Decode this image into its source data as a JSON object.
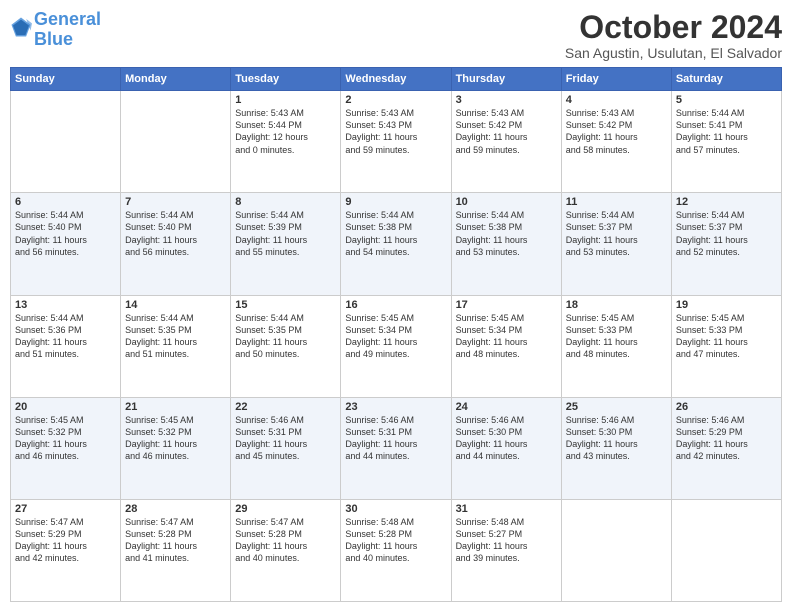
{
  "header": {
    "logo_line1": "General",
    "logo_line2": "Blue",
    "month_title": "October 2024",
    "location": "San Agustin, Usulutan, El Salvador"
  },
  "days_of_week": [
    "Sunday",
    "Monday",
    "Tuesday",
    "Wednesday",
    "Thursday",
    "Friday",
    "Saturday"
  ],
  "weeks": [
    [
      {
        "day": "",
        "content": ""
      },
      {
        "day": "",
        "content": ""
      },
      {
        "day": "1",
        "content": "Sunrise: 5:43 AM\nSunset: 5:44 PM\nDaylight: 12 hours\nand 0 minutes."
      },
      {
        "day": "2",
        "content": "Sunrise: 5:43 AM\nSunset: 5:43 PM\nDaylight: 11 hours\nand 59 minutes."
      },
      {
        "day": "3",
        "content": "Sunrise: 5:43 AM\nSunset: 5:42 PM\nDaylight: 11 hours\nand 59 minutes."
      },
      {
        "day": "4",
        "content": "Sunrise: 5:43 AM\nSunset: 5:42 PM\nDaylight: 11 hours\nand 58 minutes."
      },
      {
        "day": "5",
        "content": "Sunrise: 5:44 AM\nSunset: 5:41 PM\nDaylight: 11 hours\nand 57 minutes."
      }
    ],
    [
      {
        "day": "6",
        "content": "Sunrise: 5:44 AM\nSunset: 5:40 PM\nDaylight: 11 hours\nand 56 minutes."
      },
      {
        "day": "7",
        "content": "Sunrise: 5:44 AM\nSunset: 5:40 PM\nDaylight: 11 hours\nand 56 minutes."
      },
      {
        "day": "8",
        "content": "Sunrise: 5:44 AM\nSunset: 5:39 PM\nDaylight: 11 hours\nand 55 minutes."
      },
      {
        "day": "9",
        "content": "Sunrise: 5:44 AM\nSunset: 5:38 PM\nDaylight: 11 hours\nand 54 minutes."
      },
      {
        "day": "10",
        "content": "Sunrise: 5:44 AM\nSunset: 5:38 PM\nDaylight: 11 hours\nand 53 minutes."
      },
      {
        "day": "11",
        "content": "Sunrise: 5:44 AM\nSunset: 5:37 PM\nDaylight: 11 hours\nand 53 minutes."
      },
      {
        "day": "12",
        "content": "Sunrise: 5:44 AM\nSunset: 5:37 PM\nDaylight: 11 hours\nand 52 minutes."
      }
    ],
    [
      {
        "day": "13",
        "content": "Sunrise: 5:44 AM\nSunset: 5:36 PM\nDaylight: 11 hours\nand 51 minutes."
      },
      {
        "day": "14",
        "content": "Sunrise: 5:44 AM\nSunset: 5:35 PM\nDaylight: 11 hours\nand 51 minutes."
      },
      {
        "day": "15",
        "content": "Sunrise: 5:44 AM\nSunset: 5:35 PM\nDaylight: 11 hours\nand 50 minutes."
      },
      {
        "day": "16",
        "content": "Sunrise: 5:45 AM\nSunset: 5:34 PM\nDaylight: 11 hours\nand 49 minutes."
      },
      {
        "day": "17",
        "content": "Sunrise: 5:45 AM\nSunset: 5:34 PM\nDaylight: 11 hours\nand 48 minutes."
      },
      {
        "day": "18",
        "content": "Sunrise: 5:45 AM\nSunset: 5:33 PM\nDaylight: 11 hours\nand 48 minutes."
      },
      {
        "day": "19",
        "content": "Sunrise: 5:45 AM\nSunset: 5:33 PM\nDaylight: 11 hours\nand 47 minutes."
      }
    ],
    [
      {
        "day": "20",
        "content": "Sunrise: 5:45 AM\nSunset: 5:32 PM\nDaylight: 11 hours\nand 46 minutes."
      },
      {
        "day": "21",
        "content": "Sunrise: 5:45 AM\nSunset: 5:32 PM\nDaylight: 11 hours\nand 46 minutes."
      },
      {
        "day": "22",
        "content": "Sunrise: 5:46 AM\nSunset: 5:31 PM\nDaylight: 11 hours\nand 45 minutes."
      },
      {
        "day": "23",
        "content": "Sunrise: 5:46 AM\nSunset: 5:31 PM\nDaylight: 11 hours\nand 44 minutes."
      },
      {
        "day": "24",
        "content": "Sunrise: 5:46 AM\nSunset: 5:30 PM\nDaylight: 11 hours\nand 44 minutes."
      },
      {
        "day": "25",
        "content": "Sunrise: 5:46 AM\nSunset: 5:30 PM\nDaylight: 11 hours\nand 43 minutes."
      },
      {
        "day": "26",
        "content": "Sunrise: 5:46 AM\nSunset: 5:29 PM\nDaylight: 11 hours\nand 42 minutes."
      }
    ],
    [
      {
        "day": "27",
        "content": "Sunrise: 5:47 AM\nSunset: 5:29 PM\nDaylight: 11 hours\nand 42 minutes."
      },
      {
        "day": "28",
        "content": "Sunrise: 5:47 AM\nSunset: 5:28 PM\nDaylight: 11 hours\nand 41 minutes."
      },
      {
        "day": "29",
        "content": "Sunrise: 5:47 AM\nSunset: 5:28 PM\nDaylight: 11 hours\nand 40 minutes."
      },
      {
        "day": "30",
        "content": "Sunrise: 5:48 AM\nSunset: 5:28 PM\nDaylight: 11 hours\nand 40 minutes."
      },
      {
        "day": "31",
        "content": "Sunrise: 5:48 AM\nSunset: 5:27 PM\nDaylight: 11 hours\nand 39 minutes."
      },
      {
        "day": "",
        "content": ""
      },
      {
        "day": "",
        "content": ""
      }
    ]
  ]
}
